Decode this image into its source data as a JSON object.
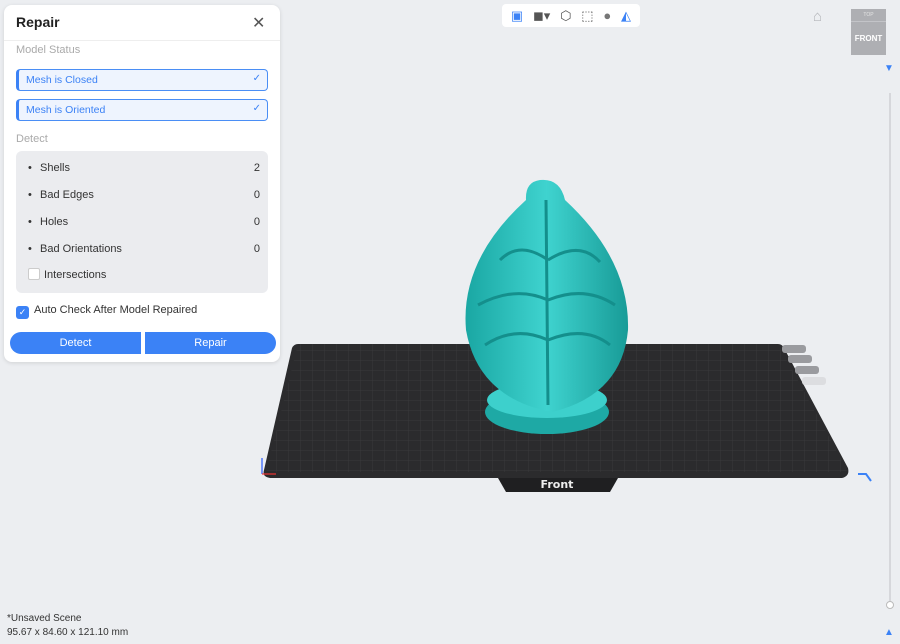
{
  "panel": {
    "title": "Repair",
    "model_status_label": "Model Status",
    "status_items": [
      "Mesh is Closed",
      "Mesh is Oriented"
    ],
    "detect_label": "Detect",
    "detect_rows": [
      {
        "label": "Shells",
        "value": "2"
      },
      {
        "label": "Bad Edges",
        "value": "0"
      },
      {
        "label": "Holes",
        "value": "0"
      },
      {
        "label": "Bad Orientations",
        "value": "0"
      }
    ],
    "intersections_label": "Intersections",
    "intersections_checked": false,
    "auto_check_label": "Auto Check After Model Repaired",
    "auto_check_checked": true,
    "detect_button": "Detect",
    "repair_button": "Repair"
  },
  "viewcube": {
    "top": "TOP",
    "front": "FRONT"
  },
  "bed_label": "Front",
  "footer": {
    "scene": "*Unsaved Scene",
    "dimensions": "95.67 x 84.60 x 121.10 mm"
  },
  "colors": {
    "accent": "#3b82f6",
    "model": "#2ec4c0",
    "bed": "#2b2b2d"
  }
}
